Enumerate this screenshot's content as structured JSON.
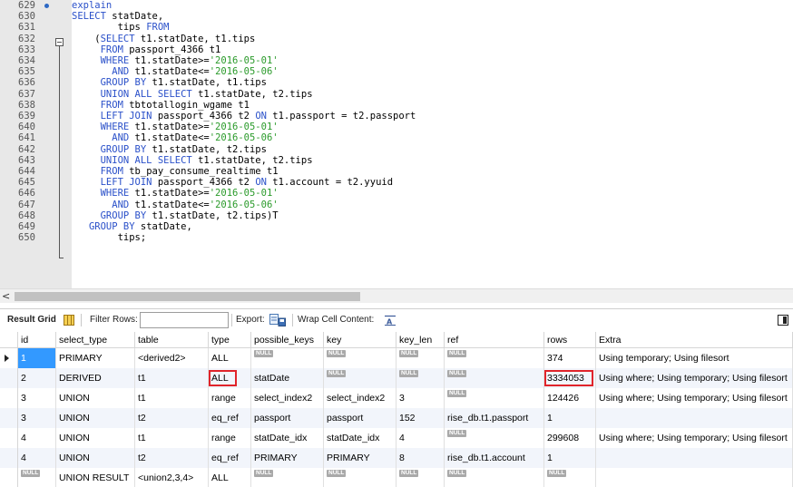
{
  "editor": {
    "lines": [
      {
        "num": "629",
        "marker": true,
        "parts": [
          [
            "kw",
            "explain"
          ]
        ]
      },
      {
        "num": "630",
        "parts": [
          [
            "kw",
            "SELECT"
          ],
          [
            "",
            " statDate,"
          ]
        ]
      },
      {
        "num": "631",
        "parts": [
          [
            "",
            "        tips "
          ],
          [
            "kw",
            "FROM"
          ]
        ]
      },
      {
        "num": "632",
        "parts": [
          [
            "",
            "    ("
          ],
          [
            "kw",
            "SELECT"
          ],
          [
            "",
            " t1.statDate, t1.tips"
          ]
        ]
      },
      {
        "num": "633",
        "parts": [
          [
            "",
            "     "
          ],
          [
            "kw",
            "FROM"
          ],
          [
            "",
            " passport_4366 t1"
          ]
        ]
      },
      {
        "num": "634",
        "parts": [
          [
            "",
            "     "
          ],
          [
            "kw",
            "WHERE"
          ],
          [
            "",
            " t1.statDate>="
          ],
          [
            "str",
            "'2016-05-01'"
          ]
        ]
      },
      {
        "num": "635",
        "parts": [
          [
            "",
            "       "
          ],
          [
            "kw",
            "AND"
          ],
          [
            "",
            " t1.statDate<="
          ],
          [
            "str",
            "'2016-05-06'"
          ]
        ]
      },
      {
        "num": "636",
        "parts": [
          [
            "",
            "     "
          ],
          [
            "kw",
            "GROUP BY"
          ],
          [
            "",
            " t1.statDate, t1.tips"
          ]
        ]
      },
      {
        "num": "637",
        "parts": [
          [
            "",
            "     "
          ],
          [
            "kw",
            "UNION ALL SELECT"
          ],
          [
            "",
            " t1.statDate, t2.tips"
          ]
        ]
      },
      {
        "num": "638",
        "parts": [
          [
            "",
            "     "
          ],
          [
            "kw",
            "FROM"
          ],
          [
            "",
            " tbtotallogin_wgame t1"
          ]
        ]
      },
      {
        "num": "639",
        "parts": [
          [
            "",
            "     "
          ],
          [
            "kw",
            "LEFT JOIN"
          ],
          [
            "",
            " passport_4366 t2 "
          ],
          [
            "kw",
            "ON"
          ],
          [
            "",
            " t1.passport = t2.passport"
          ]
        ]
      },
      {
        "num": "640",
        "parts": [
          [
            "",
            "     "
          ],
          [
            "kw",
            "WHERE"
          ],
          [
            "",
            " t1.statDate>="
          ],
          [
            "str",
            "'2016-05-01'"
          ]
        ]
      },
      {
        "num": "641",
        "parts": [
          [
            "",
            "       "
          ],
          [
            "kw",
            "AND"
          ],
          [
            "",
            " t1.statDate<="
          ],
          [
            "str",
            "'2016-05-06'"
          ]
        ]
      },
      {
        "num": "642",
        "parts": [
          [
            "",
            "     "
          ],
          [
            "kw",
            "GROUP BY"
          ],
          [
            "",
            " t1.statDate, t2.tips"
          ]
        ]
      },
      {
        "num": "643",
        "parts": [
          [
            "",
            "     "
          ],
          [
            "kw",
            "UNION ALL SELECT"
          ],
          [
            "",
            " t1.statDate, t2.tips"
          ]
        ]
      },
      {
        "num": "644",
        "parts": [
          [
            "",
            "     "
          ],
          [
            "kw",
            "FROM"
          ],
          [
            "",
            " tb_pay_consume_realtime t1"
          ]
        ]
      },
      {
        "num": "645",
        "parts": [
          [
            "",
            "     "
          ],
          [
            "kw",
            "LEFT JOIN"
          ],
          [
            "",
            " passport_4366 t2 "
          ],
          [
            "kw",
            "ON"
          ],
          [
            "",
            " t1.account = t2.yyuid"
          ]
        ]
      },
      {
        "num": "646",
        "parts": [
          [
            "",
            "     "
          ],
          [
            "kw",
            "WHERE"
          ],
          [
            "",
            " t1.statDate>="
          ],
          [
            "str",
            "'2016-05-01'"
          ]
        ]
      },
      {
        "num": "647",
        "parts": [
          [
            "",
            "       "
          ],
          [
            "kw",
            "AND"
          ],
          [
            "",
            " t1.statDate<="
          ],
          [
            "str",
            "'2016-05-06'"
          ]
        ]
      },
      {
        "num": "648",
        "parts": [
          [
            "",
            "     "
          ],
          [
            "kw",
            "GROUP BY"
          ],
          [
            "",
            " t1.statDate, t2.tips)T"
          ]
        ]
      },
      {
        "num": "649",
        "parts": [
          [
            "",
            "   "
          ],
          [
            "kw",
            "GROUP BY"
          ],
          [
            "",
            " statDate,"
          ]
        ]
      },
      {
        "num": "650",
        "parts": [
          [
            "",
            "        tips;"
          ]
        ]
      }
    ]
  },
  "scrollbar": {
    "left_arrow": "<"
  },
  "toolbar": {
    "result_grid_tab": "Result Grid",
    "grid_icon": "grid-icon",
    "filter_label": "Filter Rows:",
    "filter_value": "",
    "export_label": "Export:",
    "export_icon": "export-icon",
    "wrap_label": "Wrap Cell Content:",
    "wrap_icon": "wrap-text-icon",
    "panel_toggle_icon": "side-panel-toggle-icon"
  },
  "grid": {
    "null_label": "NULL",
    "columns": [
      "id",
      "select_type",
      "table",
      "type",
      "possible_keys",
      "key",
      "key_len",
      "ref",
      "rows",
      "Extra"
    ],
    "rows": [
      {
        "cells": [
          "1",
          "PRIMARY",
          "<derived2>",
          "ALL",
          null,
          null,
          null,
          null,
          "374",
          "Using temporary; Using filesort"
        ],
        "current": true
      },
      {
        "cells": [
          "2",
          "DERIVED",
          "t1",
          "ALL",
          "statDate",
          null,
          null,
          null,
          "3334053",
          "Using where; Using temporary; Using filesort"
        ],
        "highlight": [
          3,
          8
        ]
      },
      {
        "cells": [
          "3",
          "UNION",
          "t1",
          "range",
          "select_index2",
          "select_index2",
          "3",
          null,
          "124426",
          "Using where; Using temporary; Using filesort"
        ]
      },
      {
        "cells": [
          "3",
          "UNION",
          "t2",
          "eq_ref",
          "passport",
          "passport",
          "152",
          "rise_db.t1.passport",
          "1",
          ""
        ]
      },
      {
        "cells": [
          "4",
          "UNION",
          "t1",
          "range",
          "statDate_idx",
          "statDate_idx",
          "4",
          null,
          "299608",
          "Using where; Using temporary; Using filesort"
        ]
      },
      {
        "cells": [
          "4",
          "UNION",
          "t2",
          "eq_ref",
          "PRIMARY",
          "PRIMARY",
          "8",
          "rise_db.t1.account",
          "1",
          ""
        ]
      },
      {
        "cells": [
          null,
          "UNION RESULT",
          "<union2,3,4>",
          "ALL",
          null,
          null,
          null,
          null,
          null,
          ""
        ]
      }
    ],
    "highlight_color": "#e0242b",
    "selected_color": "#3399ff"
  }
}
